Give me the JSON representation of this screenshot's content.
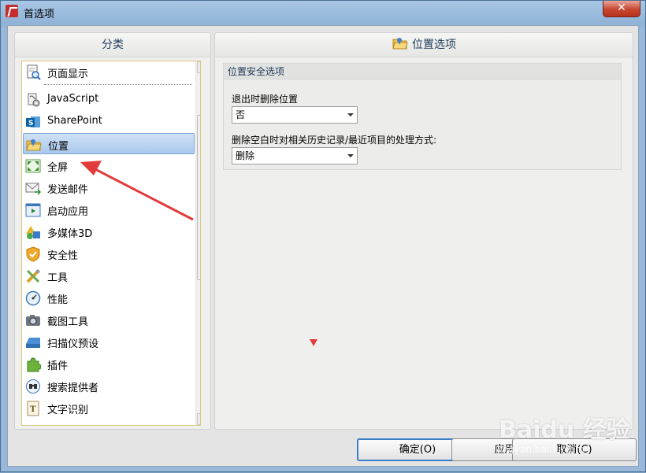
{
  "window": {
    "title": "首选项",
    "close_label": "✕"
  },
  "left_panel": {
    "header": "分类",
    "items": [
      {
        "label": "页面显示",
        "icon": "page-display-icon",
        "selected": false
      },
      {
        "label": "JavaScript",
        "icon": "javascript-icon",
        "selected": false
      },
      {
        "label": "SharePoint",
        "icon": "sharepoint-icon",
        "selected": false
      },
      {
        "label": "位置",
        "icon": "folder-location-icon",
        "selected": true
      },
      {
        "label": "全屏",
        "icon": "fullscreen-icon",
        "selected": false
      },
      {
        "label": "发送邮件",
        "icon": "email-icon",
        "selected": false
      },
      {
        "label": "启动应用",
        "icon": "launch-app-icon",
        "selected": false
      },
      {
        "label": "多媒体3D",
        "icon": "multimedia-3d-icon",
        "selected": false
      },
      {
        "label": "安全性",
        "icon": "shield-icon",
        "selected": false
      },
      {
        "label": "工具",
        "icon": "tools-icon",
        "selected": false
      },
      {
        "label": "性能",
        "icon": "performance-gauge-icon",
        "selected": false
      },
      {
        "label": "截图工具",
        "icon": "camera-icon",
        "selected": false
      },
      {
        "label": "扫描仪预设",
        "icon": "scanner-icon",
        "selected": false
      },
      {
        "label": "插件",
        "icon": "plugin-puzzle-icon",
        "selected": false
      },
      {
        "label": "搜索提供者",
        "icon": "search-provider-icon",
        "selected": false
      },
      {
        "label": "文字识别",
        "icon": "ocr-text-icon",
        "selected": false
      }
    ]
  },
  "right_panel": {
    "header": "位置选项",
    "header_icon": "folder-location-icon",
    "group_title": "位置安全选项",
    "field1_label": "退出时删除位置",
    "field1_value": "否",
    "field2_label": "删除空白时对相关历史记录/最近项目的处理方式:",
    "field2_value": "删除"
  },
  "buttons": {
    "ok": "确定(O)",
    "apply": "应用(A)",
    "cancel": "取消(C)"
  },
  "watermark": {
    "main": "Baidu 经验",
    "sub": "jingyan.baidu.com"
  },
  "colors": {
    "selection": "#a9c9ec",
    "accent": "#3c7fc8",
    "annotation_arrow": "#e23b3b"
  }
}
